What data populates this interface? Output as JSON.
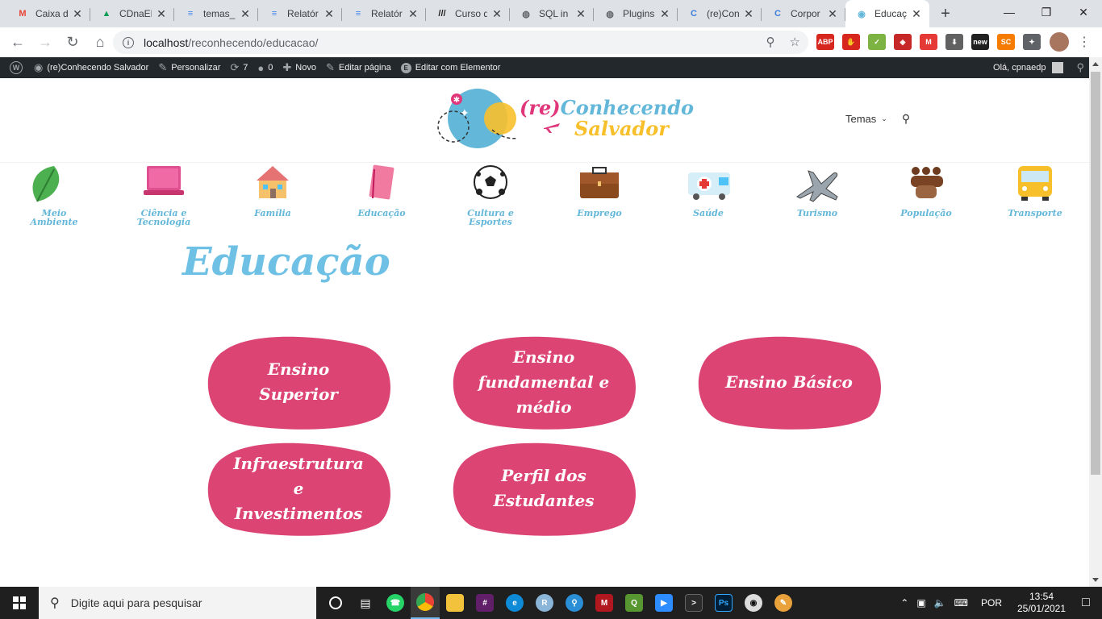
{
  "browser": {
    "tabs": [
      {
        "title": "Caixa d",
        "favicon_color": "#ea4335",
        "glyph": "M"
      },
      {
        "title": "CDnaEF",
        "favicon_color": "#0f9d58",
        "glyph": "▲"
      },
      {
        "title": "temas_",
        "favicon_color": "#4285f4",
        "glyph": "≡"
      },
      {
        "title": "Relatór",
        "favicon_color": "#4285f4",
        "glyph": "≡"
      },
      {
        "title": "Relatór",
        "favicon_color": "#4285f4",
        "glyph": "≡"
      },
      {
        "title": "Curso d",
        "favicon_color": "#1d1d1d",
        "glyph": "///"
      },
      {
        "title": "SQL in",
        "favicon_color": "#5f6368",
        "glyph": "◍"
      },
      {
        "title": "Plugins",
        "favicon_color": "#5f6368",
        "glyph": "◍"
      },
      {
        "title": "(re)Con",
        "favicon_color": "#3d7fd9",
        "glyph": "C"
      },
      {
        "title": "Corpor",
        "favicon_color": "#3d7fd9",
        "glyph": "C"
      },
      {
        "title": "Educaç",
        "favicon_color": "#63b7d9",
        "glyph": "◉",
        "active": true
      }
    ],
    "new_tab": "+",
    "url_host": "localhost",
    "url_path": "/reconhecendo/educacao/",
    "extensions": [
      {
        "label": "ABP",
        "color": "#d7261e"
      },
      {
        "label": "✋",
        "color": "#d7261e"
      },
      {
        "label": "✓",
        "color": "#7cb342"
      },
      {
        "label": "◈",
        "color": "#c62828"
      },
      {
        "label": "M",
        "color": "#e53935"
      },
      {
        "label": "⬇",
        "color": "#616161"
      },
      {
        "label": "new",
        "color": "#212121"
      },
      {
        "label": "SC",
        "color": "#f57c00"
      },
      {
        "label": "✦",
        "color": "#5f6368"
      }
    ]
  },
  "adminbar": {
    "site": "(re)Conhecendo Salvador",
    "customize": "Personalizar",
    "updates": "7",
    "comments": "0",
    "new": "Novo",
    "edit_page": "Editar página",
    "edit_elementor": "Editar com Elementor",
    "greeting": "Olá, cpnaedp"
  },
  "header": {
    "logo_re": "(re)",
    "logo_conhecendo": "Conhecendo",
    "logo_salvador": "Salvador",
    "menu_label": "Temas"
  },
  "categories": [
    {
      "line1": "Meio",
      "line2": "Ambiente",
      "icon": "leaf-icon"
    },
    {
      "line1": "Ciência e",
      "line2": "Tecnologia",
      "icon": "laptop-icon"
    },
    {
      "line1": "Família",
      "line2": "",
      "icon": "house-icon"
    },
    {
      "line1": "Educação",
      "line2": "",
      "icon": "notebook-icon"
    },
    {
      "line1": "Cultura e",
      "line2": "Esportes",
      "icon": "soccer-ball-icon"
    },
    {
      "line1": "Emprego",
      "line2": "",
      "icon": "briefcase-icon"
    },
    {
      "line1": "Saúde",
      "line2": "",
      "icon": "ambulance-icon"
    },
    {
      "line1": "Turismo",
      "line2": "",
      "icon": "airplane-icon"
    },
    {
      "line1": "População",
      "line2": "",
      "icon": "people-icon"
    },
    {
      "line1": "Transporte",
      "line2": "",
      "icon": "bus-icon"
    }
  ],
  "page": {
    "title": "Educação",
    "blob_color": "#dc4573",
    "buttons": [
      "Ensino Superior",
      "Ensino fundamental e médio",
      "Ensino Básico",
      "Infraestrutura e Investimentos",
      "Perfil dos Estudantes"
    ]
  },
  "taskbar": {
    "search_placeholder": "Digite aqui para pesquisar",
    "language": "POR",
    "time": "13:54",
    "date": "25/01/2021"
  }
}
